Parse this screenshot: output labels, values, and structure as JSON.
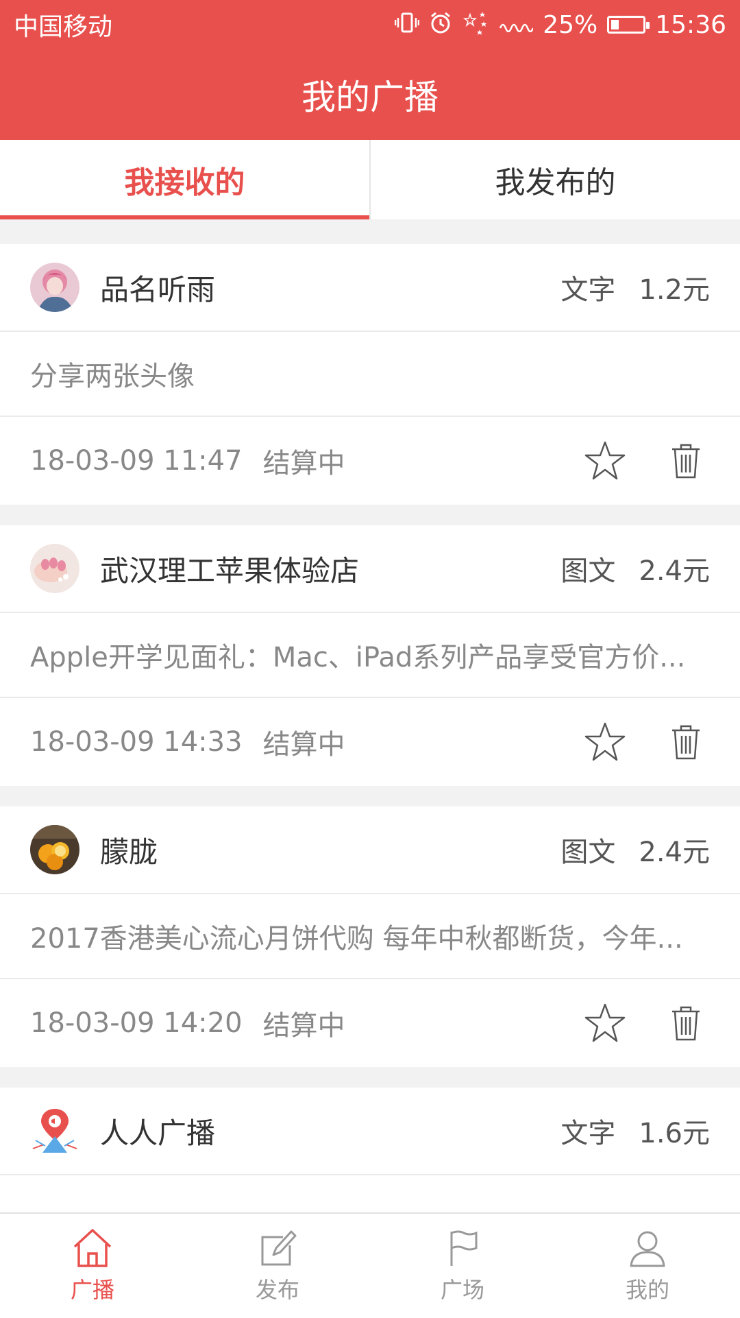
{
  "status_bar": {
    "carrier": "中国移动",
    "battery_percent": "25%",
    "battery_level": 0.25,
    "time": "15:36",
    "icons": [
      "vibrate-icon",
      "alarm-icon",
      "stars-icon",
      "signal-icon",
      "battery-icon"
    ]
  },
  "header": {
    "title": "我的广播"
  },
  "tabs": [
    {
      "label": "我接收的",
      "active": true
    },
    {
      "label": "我发布的",
      "active": false
    }
  ],
  "broadcasts": [
    {
      "name": "品名听雨",
      "type": "文字",
      "price": "1.2元",
      "description": "分享两张头像",
      "time": "18-03-09 11:47",
      "status": "结算中",
      "avatar": "avatar-pink-hair"
    },
    {
      "name": "武汉理工苹果体验店",
      "type": "图文",
      "price": "2.4元",
      "description": "Apple开学见面礼：Mac、iPad系列产品享受官方价...",
      "time": "18-03-09 14:33",
      "status": "结算中",
      "avatar": "avatar-nails"
    },
    {
      "name": "朦胧",
      "type": "图文",
      "price": "2.4元",
      "description": "2017香港美心流心月饼代购 每年中秋都断货，今年...",
      "time": "18-03-09 14:20",
      "status": "结算中",
      "avatar": "avatar-oranges"
    },
    {
      "name": "人人广播",
      "type": "文字",
      "price": "1.6元",
      "description": "",
      "time": "",
      "status": "",
      "avatar": "avatar-app-logo"
    }
  ],
  "bottom_nav": [
    {
      "label": "广播",
      "icon": "home-icon",
      "active": true
    },
    {
      "label": "发布",
      "icon": "edit-icon",
      "active": false
    },
    {
      "label": "广场",
      "icon": "flag-icon",
      "active": false
    },
    {
      "label": "我的",
      "icon": "user-icon",
      "active": false
    }
  ],
  "colors": {
    "brand": "#e8504d",
    "text_primary": "#333333",
    "text_secondary": "#888888",
    "background": "#f2f2f2"
  }
}
